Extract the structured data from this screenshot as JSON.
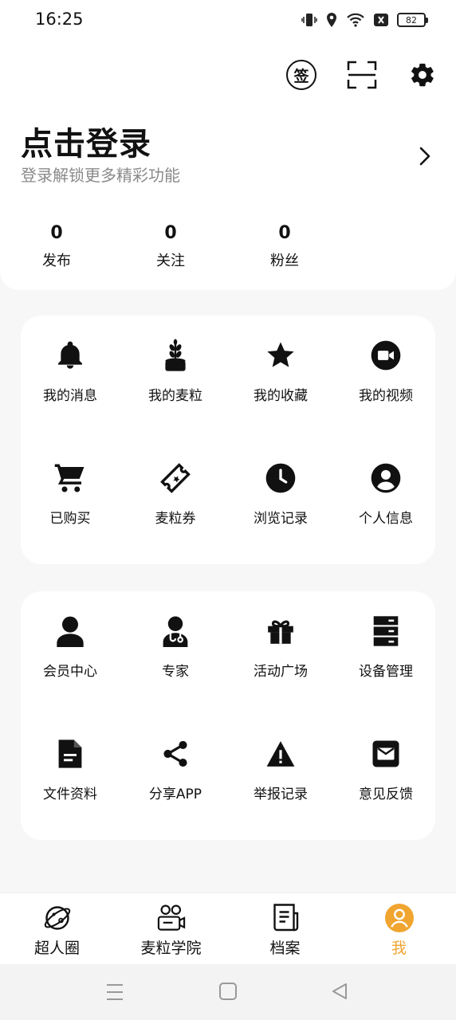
{
  "status_bar": {
    "time": "16:25",
    "battery": "82",
    "icons": [
      "vibrate-icon",
      "location-icon",
      "wifi-icon",
      "no-sim-icon",
      "battery-icon"
    ]
  },
  "header": {
    "sign_label": "签",
    "login_title": "点击登录",
    "login_subtitle": "登录解锁更多精彩功能"
  },
  "stats": [
    {
      "value": "0",
      "label": "发布"
    },
    {
      "value": "0",
      "label": "关注"
    },
    {
      "value": "0",
      "label": "粉丝"
    }
  ],
  "grid1": [
    {
      "label": "我的消息",
      "icon": "bell-icon"
    },
    {
      "label": "我的麦粒",
      "icon": "wheat-icon"
    },
    {
      "label": "我的收藏",
      "icon": "star-icon"
    },
    {
      "label": "我的视频",
      "icon": "video-icon"
    },
    {
      "label": "已购买",
      "icon": "cart-icon"
    },
    {
      "label": "麦粒券",
      "icon": "ticket-icon"
    },
    {
      "label": "浏览记录",
      "icon": "clock-icon"
    },
    {
      "label": "个人信息",
      "icon": "account-icon"
    }
  ],
  "grid2": [
    {
      "label": "会员中心",
      "icon": "person-icon"
    },
    {
      "label": "专家",
      "icon": "doctor-icon"
    },
    {
      "label": "活动广场",
      "icon": "gift-icon"
    },
    {
      "label": "设备管理",
      "icon": "server-icon"
    },
    {
      "label": "文件资料",
      "icon": "document-icon"
    },
    {
      "label": "分享APP",
      "icon": "share-icon"
    },
    {
      "label": "举报记录",
      "icon": "warning-icon"
    },
    {
      "label": "意见反馈",
      "icon": "mail-icon"
    }
  ],
  "bottom_nav": [
    {
      "label": "超人圈",
      "icon": "planet-icon"
    },
    {
      "label": "麦粒学院",
      "icon": "classroom-icon"
    },
    {
      "label": "档案",
      "icon": "archive-icon"
    },
    {
      "label": "我",
      "icon": "me-icon",
      "active": true
    }
  ],
  "colors": {
    "accent": "#f0a530",
    "background": "#f7f7f7",
    "card": "#ffffff",
    "subtext": "#8a8a8a"
  }
}
